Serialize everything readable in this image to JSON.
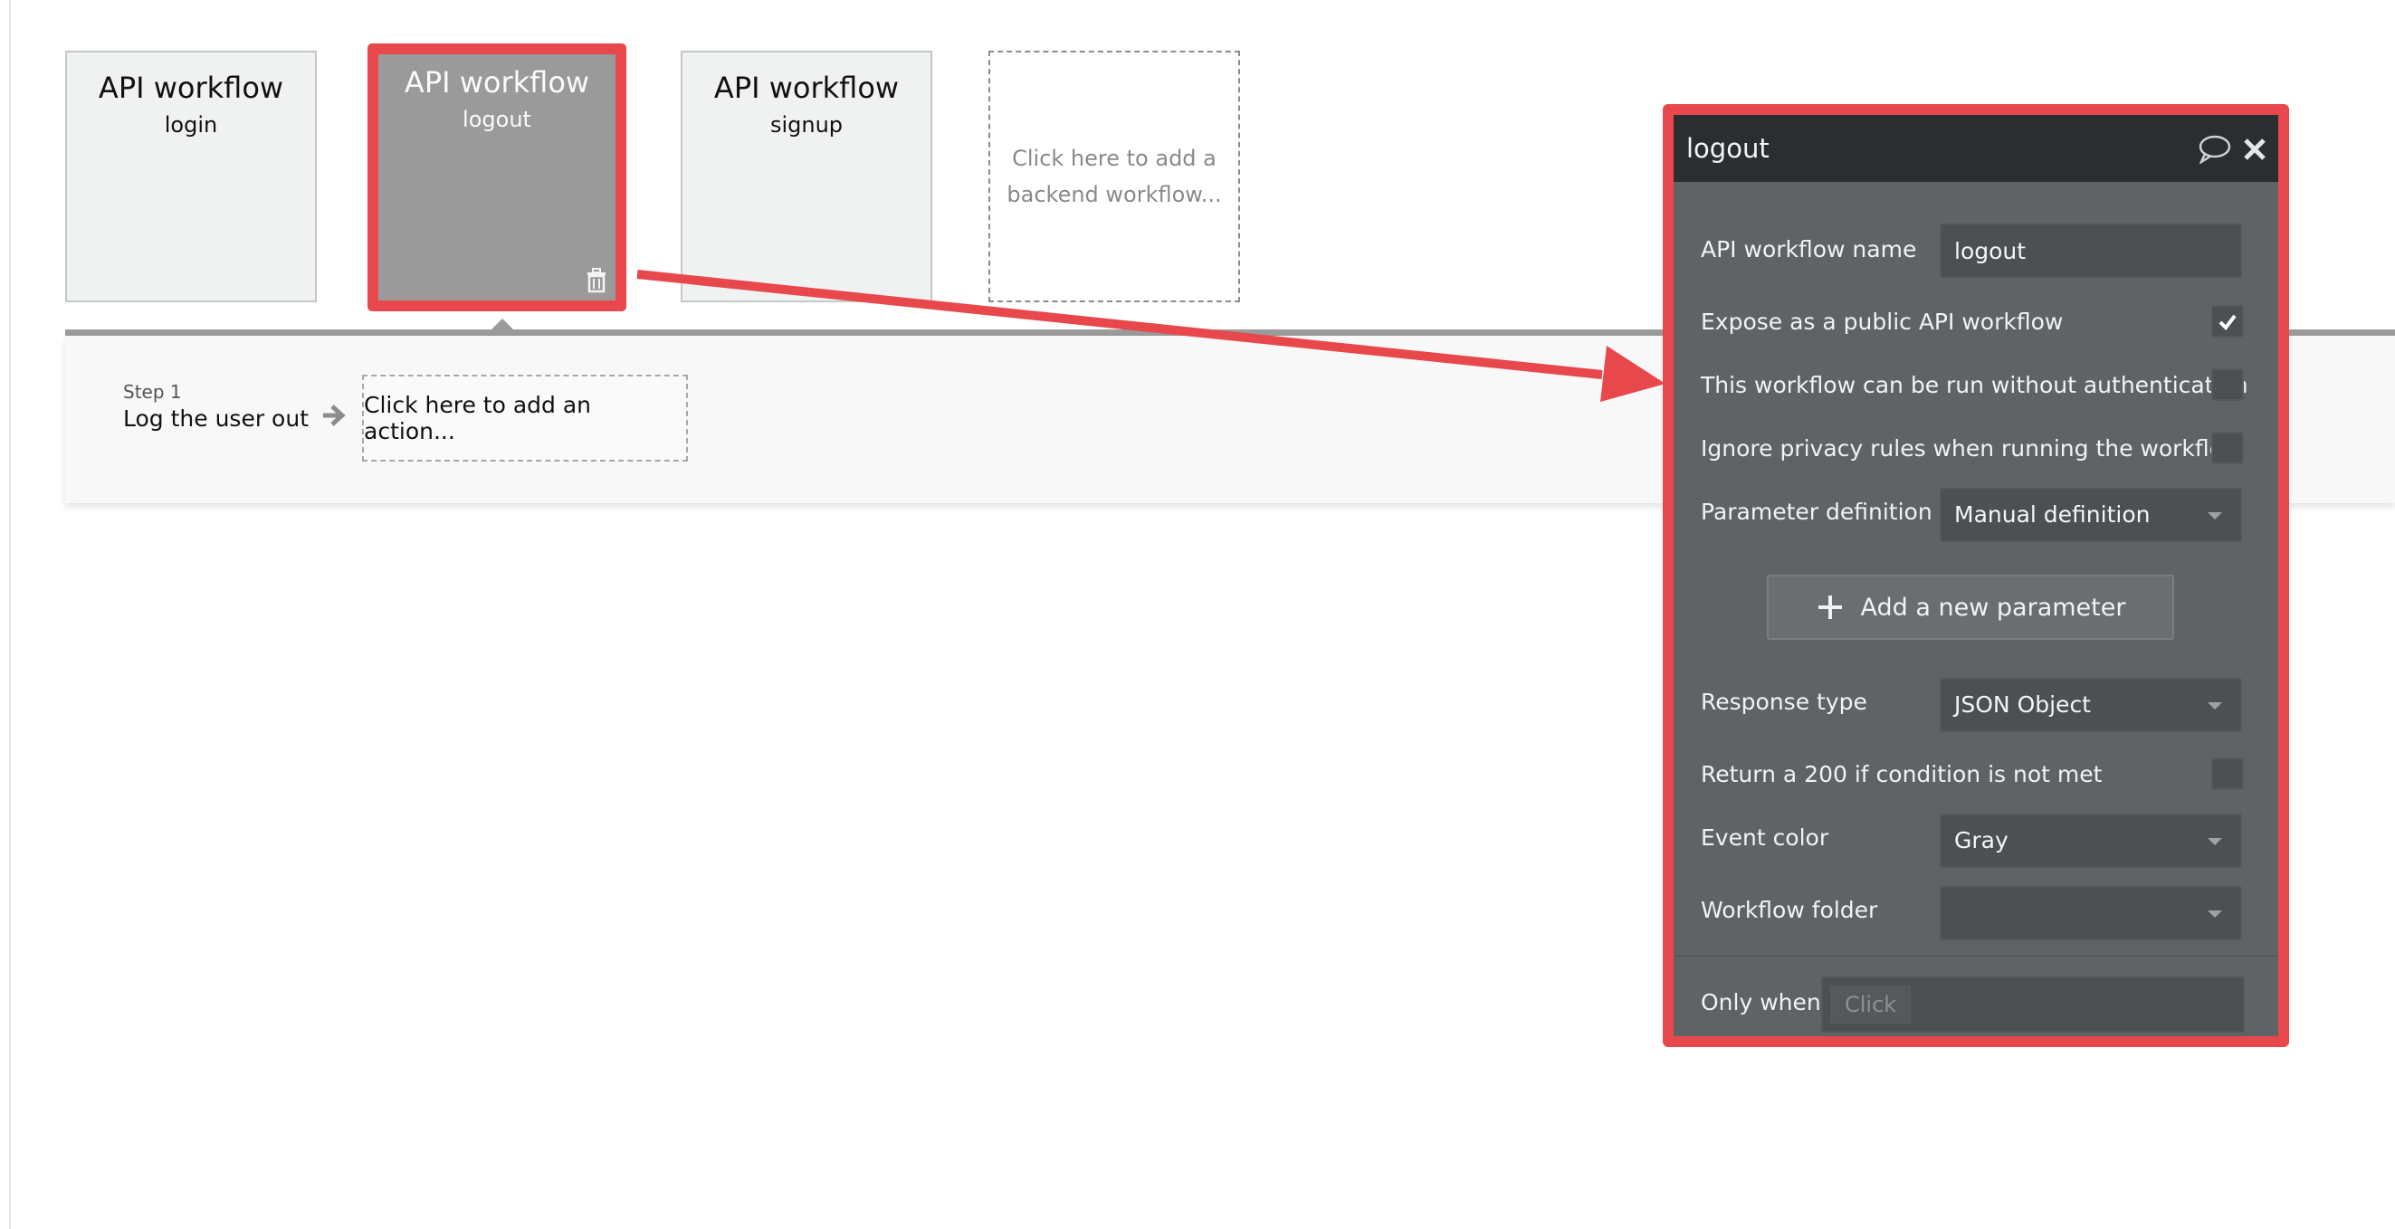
{
  "workflows": [
    {
      "title": "API workflow",
      "name": "login"
    },
    {
      "title": "API workflow",
      "name": "logout"
    },
    {
      "title": "API workflow",
      "name": "signup"
    }
  ],
  "add_workflow_text": "Click here to add a backend workflow...",
  "step": {
    "label": "Step 1",
    "title": "Log the user out",
    "add_action_text": "Click here to add an action..."
  },
  "panel": {
    "title": "logout",
    "icons": [
      "comment-icon",
      "close-icon"
    ],
    "workflow_name_label": "API workflow name",
    "workflow_name_value": "logout",
    "expose_public_label": "Expose as a public API workflow",
    "expose_public_checked": true,
    "no_auth_label": "This workflow can be run without authentication",
    "no_auth_checked": false,
    "ignore_privacy_label": "Ignore privacy rules when running the workflow",
    "ignore_privacy_checked": false,
    "param_def_label": "Parameter definition",
    "param_def_value": "Manual definition",
    "add_param_label": "Add a new parameter",
    "response_type_label": "Response type",
    "response_type_value": "JSON Object",
    "return_200_label": "Return a 200 if condition is not met",
    "return_200_checked": false,
    "event_color_label": "Event color",
    "event_color_value": "Gray",
    "folder_label": "Workflow folder",
    "folder_value": "",
    "only_when_label": "Only when",
    "only_when_placeholder": "Click"
  },
  "colors": {
    "highlight": "#e8484c",
    "panel_bg": "#5f6366",
    "panel_header_bg": "#2a2e30",
    "selected_card_bg": "#9a9a9a",
    "card_bg": "#f0f1f1"
  }
}
